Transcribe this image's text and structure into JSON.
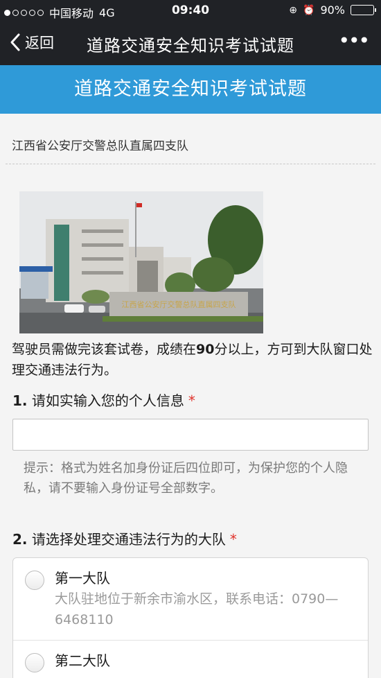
{
  "status_bar": {
    "carrier": "中国移动",
    "network": "4G",
    "time": "09:40",
    "battery": "90%",
    "battery_level": 0.9
  },
  "nav": {
    "back_label": "返回",
    "title": "道路交通安全知识考试试题",
    "more_label": "•••"
  },
  "banner": {
    "title": "道路交通安全知识考试试题"
  },
  "org": "江西省公安厅交警总队直属四支队",
  "photo": {
    "sign_text": "江西省公安厅交警总队直属四支队"
  },
  "intro": {
    "part1": "驾驶员需做完该套试卷，成绩在",
    "score": "90",
    "part2": "分以上，方可到大队窗口处理交通违法行为。"
  },
  "questions": [
    {
      "number": "1.",
      "title": "请如实输入您的个人信息",
      "required_mark": "*",
      "input_value": "",
      "hint": "提示：格式为姓名加身份证后四位即可，为保护您的个人隐私，请不要输入身份证号全部数字。"
    },
    {
      "number": "2.",
      "title": "请选择处理交通违法行为的大队",
      "required_mark": "*",
      "options": [
        {
          "label": "第一大队",
          "desc": "大队驻地位于新余市渝水区，联系电话：0790—6468110"
        },
        {
          "label": "第二大队",
          "desc": ""
        }
      ]
    }
  ]
}
